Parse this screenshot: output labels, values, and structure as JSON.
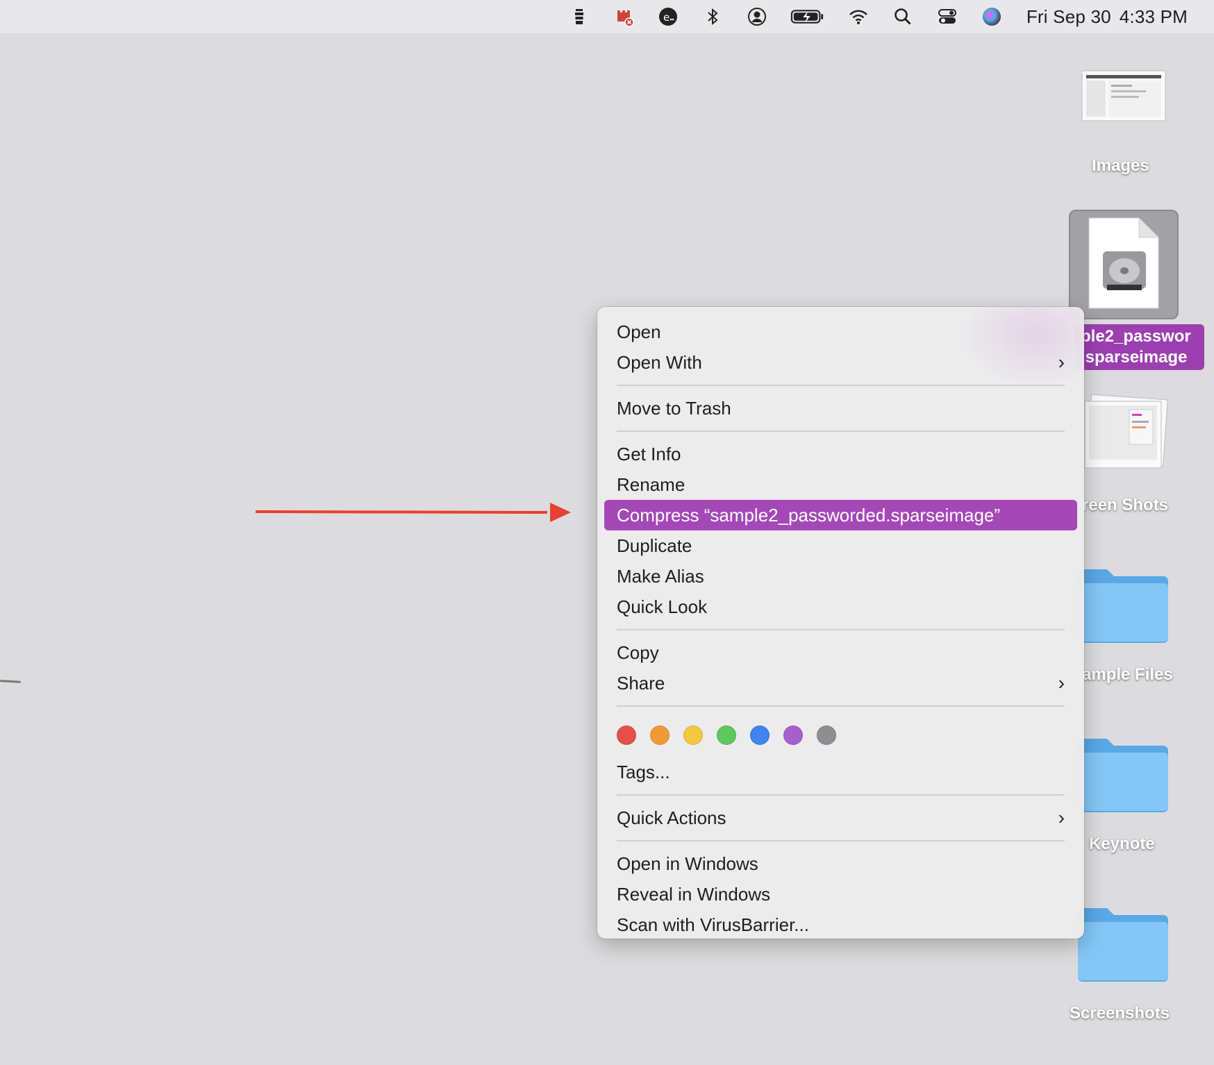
{
  "menubar": {
    "icons": [
      "lighthouse-icon",
      "virusbarrier-icon",
      "creative-cloud-icon",
      "bluetooth-icon",
      "user-account-icon",
      "battery-charging-icon",
      "wifi-icon",
      "spotlight-search-icon",
      "control-center-icon",
      "siri-icon"
    ],
    "date": "Fri Sep 30",
    "time": "4:33 PM"
  },
  "desktop": {
    "items": [
      {
        "label": "Images",
        "icon": "images-thumbnail-icon"
      },
      {
        "label_line1": "ple2_passwor",
        "label_line2": ".sparseimage",
        "icon": "disk-image-file-icon",
        "selected": true
      },
      {
        "label": "reen Shots",
        "icon": "screen-shots-thumbnail-icon"
      },
      {
        "label": "ample Files",
        "icon": "folder-icon"
      },
      {
        "label": "Keynote",
        "icon": "folder-icon"
      },
      {
        "label": "Screenshots",
        "icon": "folder-icon"
      }
    ]
  },
  "menu": {
    "open": "Open",
    "open_with": "Open With",
    "move_to_trash": "Move to Trash",
    "get_info": "Get Info",
    "rename": "Rename",
    "compress": "Compress “sample2_passworded.sparseimage”",
    "duplicate": "Duplicate",
    "make_alias": "Make Alias",
    "quick_look": "Quick Look",
    "copy": "Copy",
    "share": "Share",
    "tags_label": "Tags...",
    "quick_actions": "Quick Actions",
    "open_in_windows": "Open in Windows",
    "reveal_in_windows": "Reveal in Windows",
    "scan": "Scan with VirusBarrier...",
    "chevron": "›",
    "tag_colors": [
      "#e5514a",
      "#f09a37",
      "#f5c842",
      "#5ec75e",
      "#3f84f0",
      "#a55fce",
      "#8e8e92"
    ],
    "highlight_color": "#a448b8"
  },
  "annotation": {
    "arrow_color": "#e8402e"
  }
}
